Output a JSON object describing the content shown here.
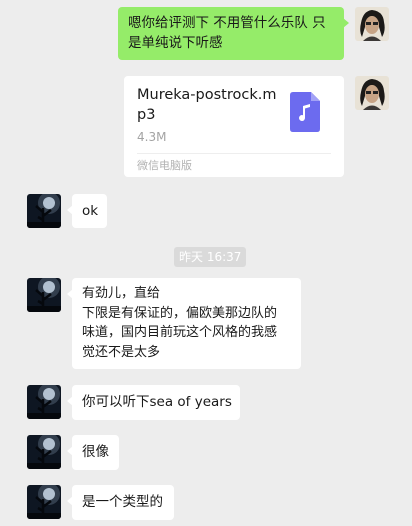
{
  "messages": [
    {
      "sender": "self",
      "type": "text",
      "text": "嗯你给评测下 不用管什么乐队 只\n是单纯说下听感"
    },
    {
      "sender": "self",
      "type": "file",
      "file": {
        "name": "Mureka-postrock.mp3",
        "size": "4.3M",
        "source": "微信电脑版",
        "icon": "music-file-icon",
        "icon_color": "#6c6bef"
      }
    },
    {
      "sender": "other",
      "type": "text",
      "text": "ok"
    },
    {
      "type": "timestamp",
      "text": "昨天 16:37"
    },
    {
      "sender": "other",
      "type": "text",
      "text": "有劲儿，直给\n下限是有保证的，偏欧美那边队的\n味道，国内目前玩这个风格的我感\n觉还不是太多"
    },
    {
      "sender": "other",
      "type": "text",
      "text": "你可以听下sea of years"
    },
    {
      "sender": "other",
      "type": "text",
      "text": "很像"
    },
    {
      "sender": "other",
      "type": "text",
      "text": "是一个类型的"
    }
  ],
  "colors": {
    "background": "#ededed",
    "self_bubble": "#95ec69",
    "other_bubble": "#ffffff",
    "timestamp_bg": "#dadada"
  }
}
